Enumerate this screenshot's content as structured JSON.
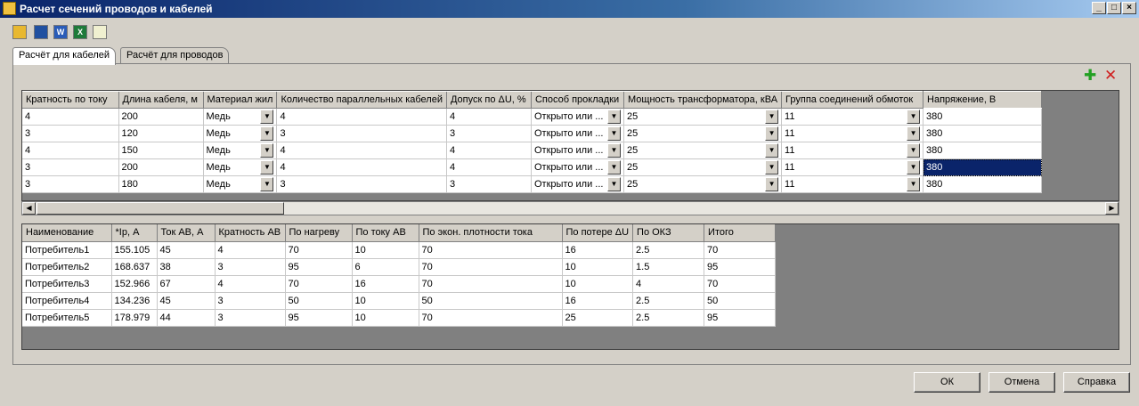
{
  "window": {
    "title": "Расчет сечений проводов и кабелей",
    "controls": [
      "_",
      "□",
      "×"
    ]
  },
  "toolbar": [
    {
      "name": "open-folder-icon",
      "glyph": "",
      "color": "#e8b830"
    },
    {
      "name": "save-icon",
      "glyph": "",
      "color": "#2050a0"
    },
    {
      "name": "word-export-icon",
      "glyph": "W",
      "color": "#2a5cb8"
    },
    {
      "name": "excel-export-icon",
      "glyph": "X",
      "color": "#1e7a3a"
    },
    {
      "name": "table-icon",
      "glyph": "",
      "color": "#f0f0d0"
    }
  ],
  "tabs": [
    {
      "label": "Расчёт для кабелей",
      "active": true
    },
    {
      "label": "Расчёт для проводов",
      "active": false
    }
  ],
  "panel_actions": {
    "add_glyph": "✚",
    "add_color": "#22a022",
    "remove_glyph": "✕",
    "remove_color": "#d02020"
  },
  "input_table": {
    "columns": [
      {
        "label": "Кратность по току",
        "combo": false
      },
      {
        "label": "Длина кабеля, м",
        "combo": false
      },
      {
        "label": "Материал жил",
        "combo": true
      },
      {
        "label": "Количество параллельных кабелей",
        "combo": false
      },
      {
        "label": "Допуск по ΔU, %",
        "combo": false
      },
      {
        "label": "Способ прокладки",
        "combo": true
      },
      {
        "label": "Мощность трансформатора, кВА",
        "combo": true
      },
      {
        "label": "Группа соединений обмоток",
        "combo": true
      },
      {
        "label": "Напряжение, В",
        "combo": false
      }
    ],
    "rows": [
      [
        "4",
        "200",
        "Медь",
        "4",
        "4",
        "Открыто или ...",
        "25",
        "11",
        "380"
      ],
      [
        "3",
        "120",
        "Медь",
        "3",
        "3",
        "Открыто или ...",
        "25",
        "11",
        "380"
      ],
      [
        "4",
        "150",
        "Медь",
        "4",
        "4",
        "Открыто или ...",
        "25",
        "11",
        "380"
      ],
      [
        "3",
        "200",
        "Медь",
        "4",
        "4",
        "Открыто или ...",
        "25",
        "11",
        "380"
      ],
      [
        "3",
        "180",
        "Медь",
        "3",
        "3",
        "Открыто или ...",
        "25",
        "11",
        "380"
      ]
    ],
    "selected_cell": {
      "row": 3,
      "col": 8
    }
  },
  "result_table": {
    "columns": [
      "Наименование",
      "*Iр, А",
      "Ток АВ, А",
      "Кратность АВ",
      "По нагреву",
      "По току АВ",
      "По экон. плотности тока",
      "По потере ΔU",
      "По ОКЗ",
      "Итого"
    ],
    "rows": [
      [
        "Потребитель1",
        "155.105",
        "45",
        "4",
        "70",
        "10",
        "70",
        "16",
        "2.5",
        "70"
      ],
      [
        "Потребитель2",
        "168.637",
        "38",
        "3",
        "95",
        "6",
        "70",
        "10",
        "1.5",
        "95"
      ],
      [
        "Потребитель3",
        "152.966",
        "67",
        "4",
        "70",
        "16",
        "70",
        "10",
        "4",
        "70"
      ],
      [
        "Потребитель4",
        "134.236",
        "45",
        "3",
        "50",
        "10",
        "50",
        "16",
        "2.5",
        "50"
      ],
      [
        "Потребитель5",
        "178.979",
        "44",
        "3",
        "95",
        "10",
        "70",
        "25",
        "2.5",
        "95"
      ]
    ]
  },
  "scrollbar": {
    "left_arrow": "◀",
    "right_arrow": "▶"
  },
  "buttons": {
    "ok": "ОК",
    "cancel": "Отмена",
    "help": "Справка"
  }
}
